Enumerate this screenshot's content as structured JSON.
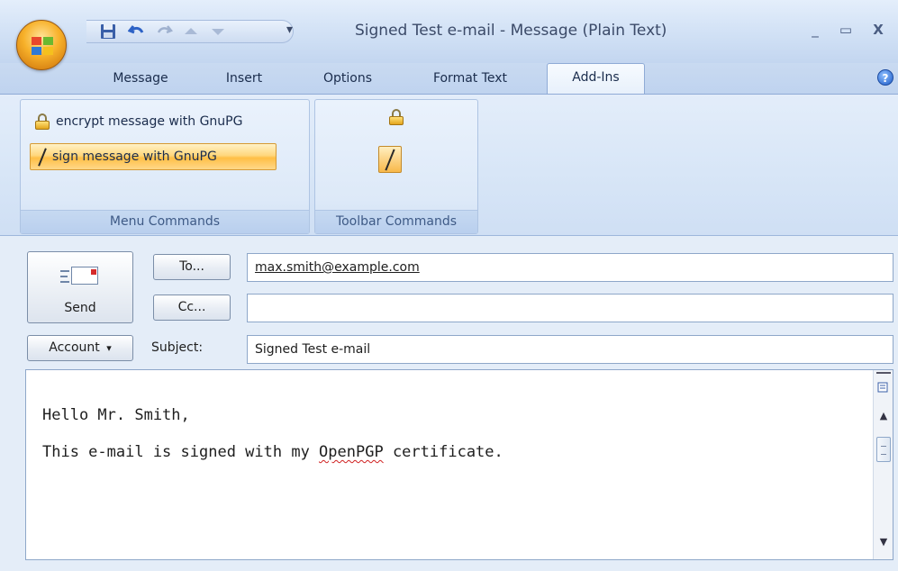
{
  "window": {
    "title": "Signed Test e-mail - Message (Plain Text)",
    "minimize_glyph": "_",
    "maximize_glyph": "▭",
    "close_glyph": "X",
    "help_glyph": "?"
  },
  "quick_access": {
    "icons": [
      "save-icon",
      "undo-icon",
      "redo-icon",
      "previous-item-icon",
      "next-item-icon",
      "customize-qat-icon"
    ],
    "customize_glyph": "▾"
  },
  "tabs": [
    {
      "label": "Message",
      "active": false
    },
    {
      "label": "Insert",
      "active": false
    },
    {
      "label": "Options",
      "active": false
    },
    {
      "label": "Format Text",
      "active": false
    },
    {
      "label": "Add-Ins",
      "active": true
    }
  ],
  "ribbon": {
    "menu_group": {
      "label": "Menu Commands",
      "encrypt_label": "encrypt message with GnuPG",
      "sign_label": "sign message with GnuPG"
    },
    "toolbar_group": {
      "label": "Toolbar Commands"
    }
  },
  "compose": {
    "send_label": "Send",
    "to_button": "To...",
    "cc_button": "Cc...",
    "account_button": "Account",
    "account_arrow": "▾",
    "subject_label": "Subject:",
    "to_value": "max.smith@example.com",
    "cc_value": "",
    "subject_value": "Signed Test e-mail"
  },
  "body": {
    "line1": "Hello Mr. Smith,",
    "line2_prefix": "This e-mail is signed with my ",
    "line2_misspelled": "OpenPGP",
    "line2_suffix": " certificate."
  },
  "colors": {
    "ribbon_bg": "#d8e6f7",
    "highlight": "#ffd77d",
    "accent": "#1d5bc7"
  }
}
